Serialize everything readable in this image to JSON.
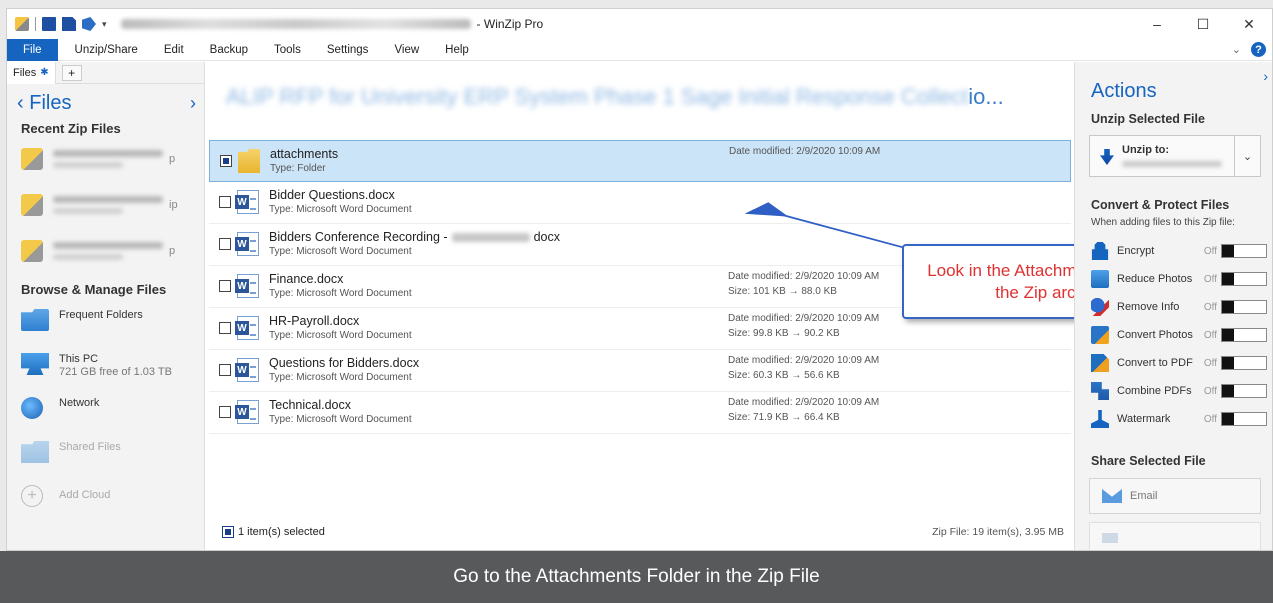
{
  "window": {
    "title_suffix": "- WinZip Pro",
    "controls": {
      "minimize": "–",
      "maximize": "☐",
      "close": "✕"
    }
  },
  "menu": {
    "items": [
      "File",
      "Unzip/Share",
      "Edit",
      "Backup",
      "Tools",
      "Settings",
      "View",
      "Help"
    ],
    "collapse": "⌄",
    "help": "?"
  },
  "left_panel": {
    "tab_label": "Files",
    "tab_plus": "+",
    "header": "Files",
    "back": "‹",
    "forward": "›",
    "recent_title": "Recent Zip Files",
    "recent_items": [
      {
        "ext": "p"
      },
      {
        "ext": "ip"
      },
      {
        "ext": "p"
      }
    ],
    "browse_title": "Browse & Manage Files",
    "locations": [
      {
        "label": "Frequent Folders",
        "sub": ""
      },
      {
        "label": "This PC",
        "sub": "721 GB free of 1.03 TB"
      },
      {
        "label": "Network",
        "sub": ""
      },
      {
        "label": "Shared Files",
        "sub": ""
      },
      {
        "label": "Add Cloud",
        "sub": ""
      }
    ]
  },
  "center": {
    "zip_title_visible": "io...",
    "files": [
      {
        "name": "attachments",
        "type": "Type: Folder",
        "date": "Date modified: 2/9/2020 10:09 AM",
        "size": "",
        "selected": true
      },
      {
        "name": "Bidder Questions.docx",
        "type": "Type: Microsoft Word Document",
        "date": "",
        "size": "",
        "selected": false
      },
      {
        "name": "Bidders Conference Recording -",
        "name_suffix": "docx",
        "type": "Type: Microsoft Word Document",
        "date": "",
        "size": "",
        "selected": false
      },
      {
        "name": "Finance.docx",
        "type": "Type: Microsoft Word Document",
        "date": "Date modified: 2/9/2020 10:09 AM",
        "size": "Size: 101 KB → 88.0 KB",
        "selected": false
      },
      {
        "name": "HR-Payroll.docx",
        "type": "Type: Microsoft Word Document",
        "date": "Date modified: 2/9/2020 10:09 AM",
        "size": "Size: 99.8 KB → 90.2 KB",
        "selected": false
      },
      {
        "name": "Questions for Bidders.docx",
        "type": "Type: Microsoft Word Document",
        "date": "Date modified: 2/9/2020 10:09 AM",
        "size": "Size: 60.3 KB → 56.6 KB",
        "selected": false
      },
      {
        "name": "Technical.docx",
        "type": "Type: Microsoft Word Document",
        "date": "Date modified: 2/9/2020 10:09 AM",
        "size": "Size: 71.9 KB → 66.4 KB",
        "selected": false
      }
    ],
    "status_selected": "1 item(s) selected",
    "status_zip": "Zip File: 19 item(s), 3.95 MB",
    "callout": "Look in the Attachments folder of the Zip archive"
  },
  "right_panel": {
    "title": "Actions",
    "chevron": "›",
    "unzip_section": "Unzip Selected File",
    "unzip_label": "Unzip to:",
    "unzip_dropdown": "⌄",
    "convert_section": "Convert & Protect Files",
    "convert_sub": "When adding files to this Zip file:",
    "options": [
      {
        "label": "Encrypt",
        "state": "Off"
      },
      {
        "label": "Reduce Photos",
        "state": "Off"
      },
      {
        "label": "Remove Info",
        "state": "Off"
      },
      {
        "label": "Convert Photos",
        "state": "Off"
      },
      {
        "label": "Convert to PDF",
        "state": "Off"
      },
      {
        "label": "Combine PDFs",
        "state": "Off"
      },
      {
        "label": "Watermark",
        "state": "Off"
      }
    ],
    "share_section": "Share Selected File",
    "email_label": "Email"
  },
  "caption": "Go to the Attachments Folder in the Zip File"
}
